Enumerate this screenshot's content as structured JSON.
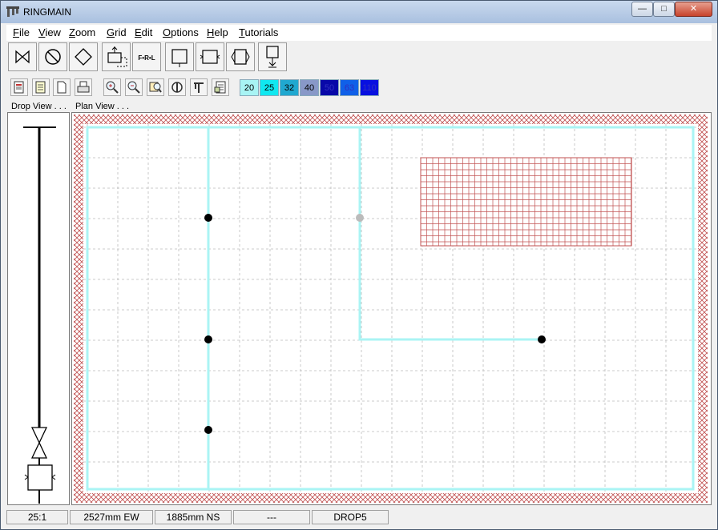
{
  "window": {
    "title": "RINGMAIN"
  },
  "title_controls": {
    "minimize": "—",
    "maximize": "□",
    "close": "✕"
  },
  "menu": [
    {
      "label": "File",
      "underline": "F",
      "rest": "ile"
    },
    {
      "label": "View",
      "underline": "V",
      "rest": "iew"
    },
    {
      "label": "Zoom",
      "underline": "Z",
      "rest": "oom"
    },
    {
      "label": "Grid",
      "underline": "G",
      "rest": "rid"
    },
    {
      "label": "Edit",
      "underline": "E",
      "rest": "dit"
    },
    {
      "label": "Options",
      "underline": "O",
      "rest": "ptions"
    },
    {
      "label": "Help",
      "underline": "H",
      "rest": "elp"
    },
    {
      "label": "Tutorials",
      "underline": "T",
      "rest": "utorials"
    }
  ],
  "toolbar_primary": [
    {
      "icon": "gate-valve-icon"
    },
    {
      "icon": "no-entry-icon"
    },
    {
      "icon": "diamond-icon"
    },
    {
      "icon": "ramp-icon"
    },
    {
      "icon": "frl-icon",
      "label": "F•R•L"
    },
    {
      "icon": "drop-box-icon"
    },
    {
      "icon": "lubricator-icon"
    },
    {
      "icon": "filter-icon"
    },
    {
      "icon": "drain-icon"
    }
  ],
  "toolbar_secondary": [
    {
      "icon": "new-icon"
    },
    {
      "icon": "open-icon"
    },
    {
      "icon": "page-icon"
    },
    {
      "icon": "print-icon"
    },
    {
      "icon": "zoom-in-icon"
    },
    {
      "icon": "zoom-out-icon"
    },
    {
      "icon": "zoom-fit-icon"
    },
    {
      "icon": "center-icon"
    },
    {
      "icon": "pipe-icon"
    },
    {
      "icon": "report-icon"
    }
  ],
  "pipe_sizes": [
    {
      "label": "20",
      "color": "#a8f4f4"
    },
    {
      "label": "25",
      "color": "#10e8f0"
    },
    {
      "label": "32",
      "color": "#20a8d0"
    },
    {
      "label": "40",
      "color": "#8898c8"
    },
    {
      "label": "50",
      "color": "#0808a8"
    },
    {
      "label": "63",
      "color": "#1060e8"
    },
    {
      "label": "110",
      "color": "#0810e0"
    }
  ],
  "panels": {
    "drop_label": "Drop View . . .",
    "plan_label": "Plan View . . ."
  },
  "status": {
    "scale": "25:1",
    "ew": "2527mm EW",
    "ns": "1885mm NS",
    "mode": "---",
    "item": "DROP5"
  },
  "colors": {
    "pipe": "#aaf4f4",
    "hatch": "#c05050",
    "grid": "#bbbbbb",
    "node": "#000000",
    "node_inactive": "#bbbbbb"
  }
}
